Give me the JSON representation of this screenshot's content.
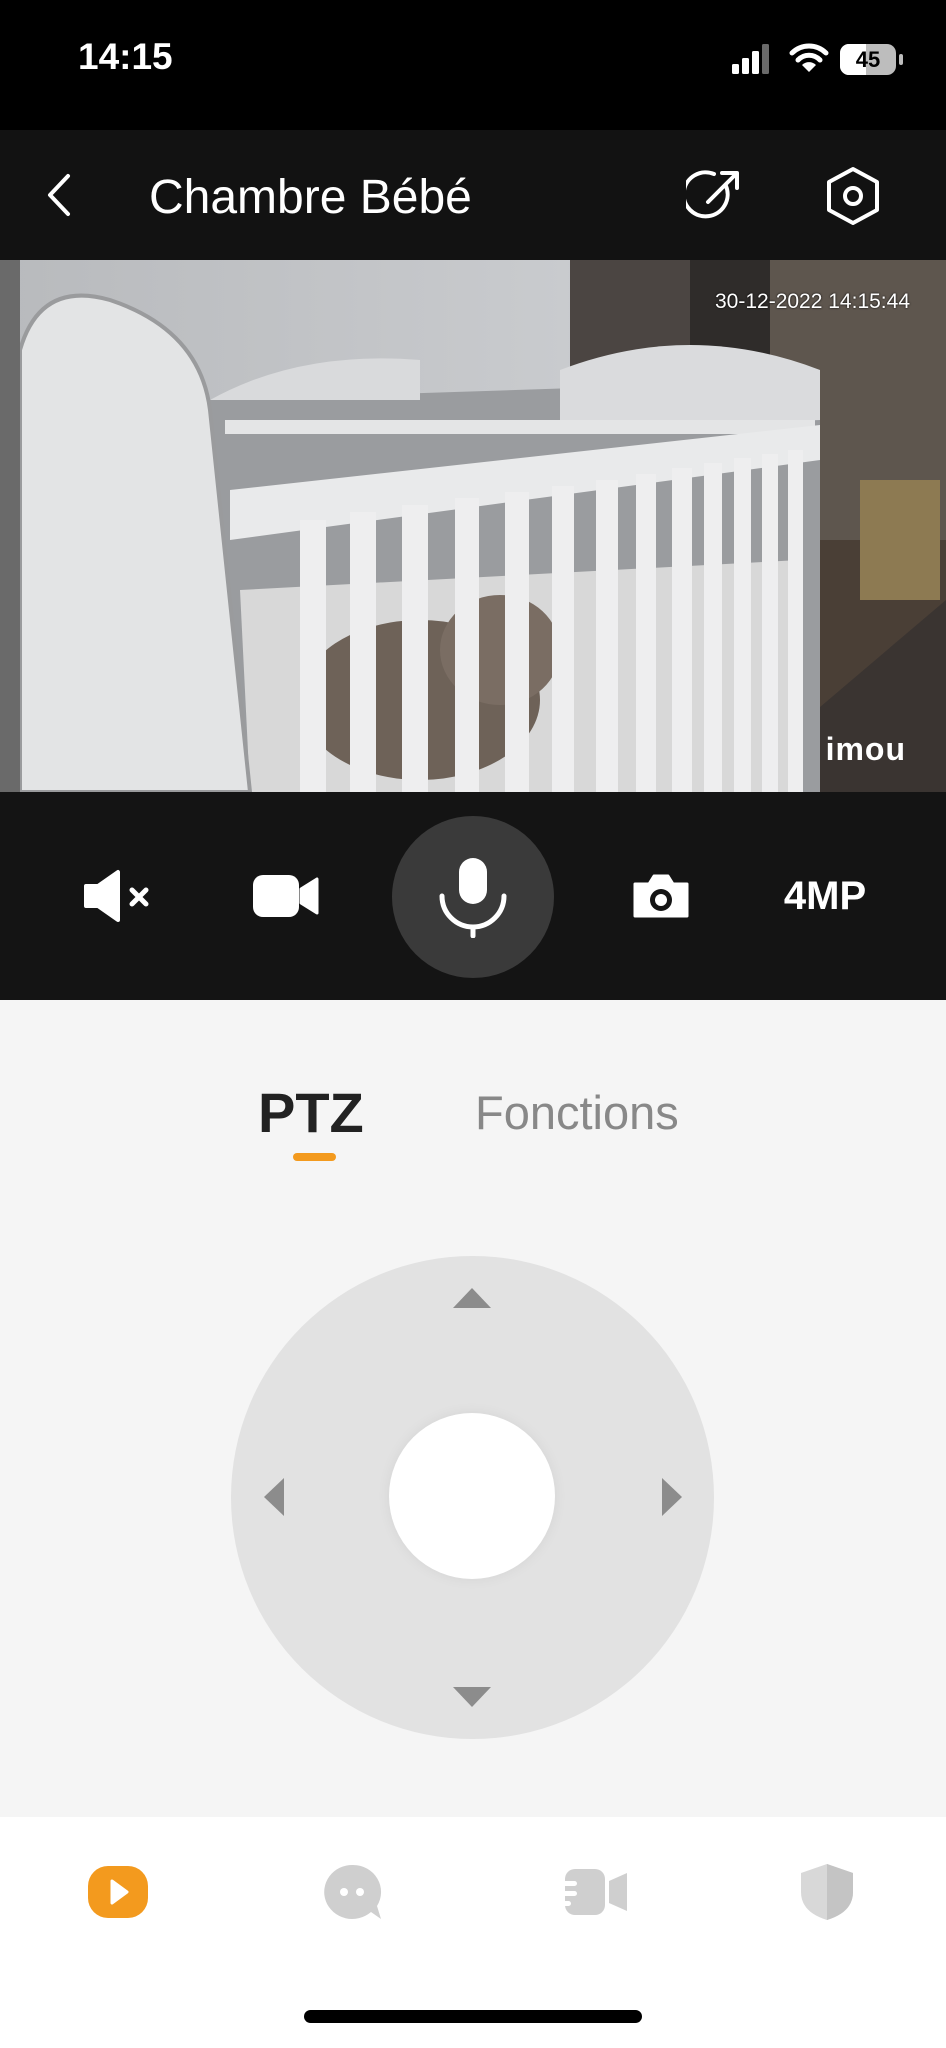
{
  "status_bar": {
    "time": "14:15",
    "battery": "45"
  },
  "header": {
    "title": "Chambre Bébé"
  },
  "video": {
    "timestamp": "30-12-2022 14:15:44",
    "logo": "imou"
  },
  "controls": {
    "items": [
      {
        "icon": "speaker-muted-icon"
      },
      {
        "icon": "video-record-icon"
      },
      {
        "icon": "microphone-icon"
      },
      {
        "icon": "camera-snapshot-icon"
      }
    ],
    "resolution": "4MP"
  },
  "tabs": {
    "items": [
      "PTZ",
      "Fonctions"
    ],
    "active": "PTZ",
    "accent": "#f39a1e"
  },
  "bottom_nav": {
    "items": [
      {
        "icon": "live-play-icon",
        "active": true
      },
      {
        "icon": "chat-bubble-icon",
        "active": false
      },
      {
        "icon": "recordings-icon",
        "active": false
      },
      {
        "icon": "shield-icon",
        "active": false
      }
    ],
    "active_color": "#f39a1e",
    "inactive_color": "#cfcfcf"
  }
}
